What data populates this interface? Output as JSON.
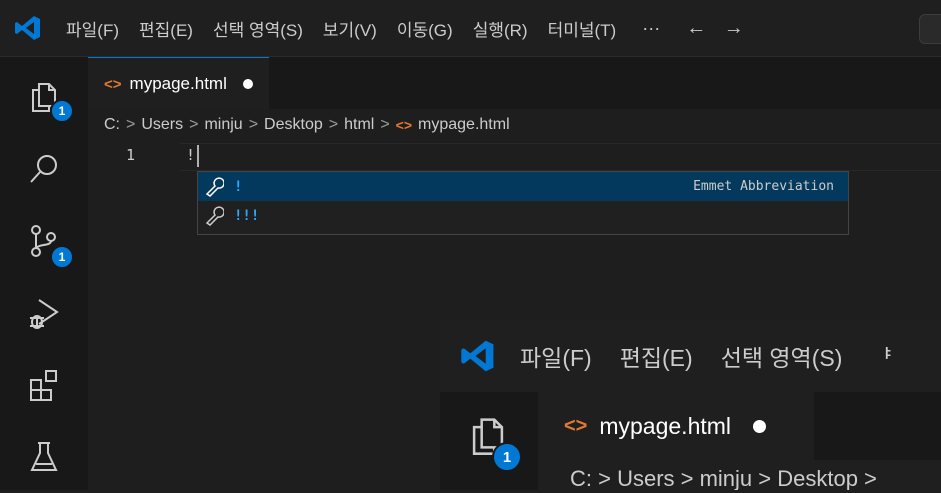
{
  "menu": {
    "items": [
      "파일(F)",
      "편집(E)",
      "선택 영역(S)",
      "보기(V)",
      "이동(G)",
      "실행(R)",
      "터미널(T)"
    ],
    "more": "···",
    "nav_arrows": "← →"
  },
  "activity": {
    "explorer_badge": "1",
    "source_control_badge": "1"
  },
  "tab": {
    "label": "mypage.html",
    "icon": "<>"
  },
  "breadcrumb": {
    "parts": [
      "C:",
      "Users",
      "minju",
      "Desktop",
      "html"
    ],
    "separator": ">",
    "file_icon": "<>",
    "file": "mypage.html"
  },
  "editor": {
    "line_number": "1",
    "code": "!"
  },
  "suggestions": [
    {
      "label": "!",
      "detail": "Emmet Abbreviation",
      "selected": true
    },
    {
      "label": "!!!",
      "detail": "",
      "selected": false
    }
  ],
  "overlay": {
    "menu_items": [
      "파일(F)",
      "편집(E)",
      "선택 영역(S)",
      "ᅣ"
    ],
    "badge": "1",
    "tab_icon": "<>",
    "tab_label": "mypage.html",
    "breadcrumb": "C: > Users > minju > Desktop >"
  },
  "colors": {
    "accent": "#0078d4",
    "html_icon": "#e37933",
    "suggest_highlight": "#2aaaff",
    "selected_row": "#04395e"
  }
}
